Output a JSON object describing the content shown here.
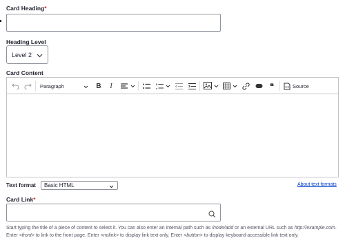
{
  "card_heading": {
    "label": "Card Heading",
    "required_mark": "*",
    "value": ""
  },
  "heading_level": {
    "label": "Heading Level",
    "selected": "Level 2"
  },
  "card_content": {
    "label": "Card Content",
    "toolbar": {
      "paragraph_label": "Paragraph",
      "source_label": "Source"
    }
  },
  "text_format": {
    "label": "Text format",
    "selected": "Basic HTML",
    "about_link": "About text formats"
  },
  "card_link": {
    "label": "Card Link",
    "required_mark": "*",
    "value": "",
    "help": {
      "t1": "Start typing the title of a piece of content to select it. You can also enter an internal path such as ",
      "node_add": "/node/add",
      "t2": " or an external URL such as ",
      "example": "http://example.com",
      "t3": ". Enter ",
      "front": "<front>",
      "t4": " to link to the front page. Enter ",
      "nolink": "<nolink>",
      "t5": " to display link text only. Enter ",
      "button": "<button>",
      "t6": " to display keyboard-accessible link text only."
    }
  }
}
